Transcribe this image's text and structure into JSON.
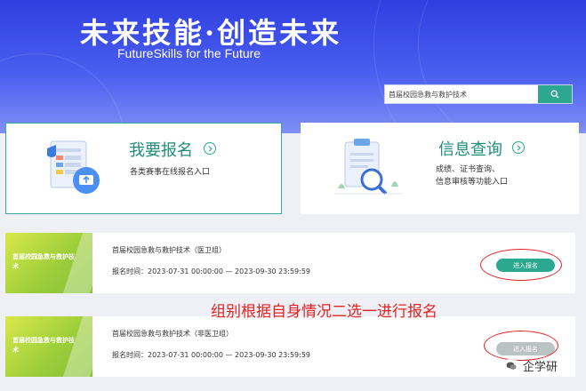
{
  "hero": {
    "slogan_cn": "未来技能·创造未来",
    "slogan_en": "FutureSkills  for the Future"
  },
  "search": {
    "value": "首届校园急救与救护技术",
    "icon": "search-icon"
  },
  "cards": {
    "signup": {
      "title": "我要报名",
      "subtitle": "各类赛事在线报名入口",
      "icon": "arrow-right-circle-icon"
    },
    "query": {
      "title": "信息查询",
      "subtitle_line1": "成绩、证书查询、",
      "subtitle_line2": "信息审核等功能入口",
      "icon": "arrow-right-circle-icon"
    }
  },
  "competitions": [
    {
      "thumb_text": "首届校园急救与救护技术",
      "name": "首届校园急救与救护技术（医卫组）",
      "time": "报名时间：2023-07-31 00:00:00  —  2023-09-30 23:59:59",
      "button": "进入报名"
    },
    {
      "thumb_text": "首届校园急救与救护技术",
      "name": "首届校园急救与救护技术（非医卫组）",
      "time": "报名时间：2023-07-31 00:00:00  —  2023-09-30 23:59:59",
      "button": "进入报名"
    }
  ],
  "annotation": "组别根据自身情况二选一进行报名",
  "watermark": "企学研",
  "colors": {
    "primary": "#2ca891",
    "hero": "#3a4ce8",
    "annotation": "#e32222"
  }
}
